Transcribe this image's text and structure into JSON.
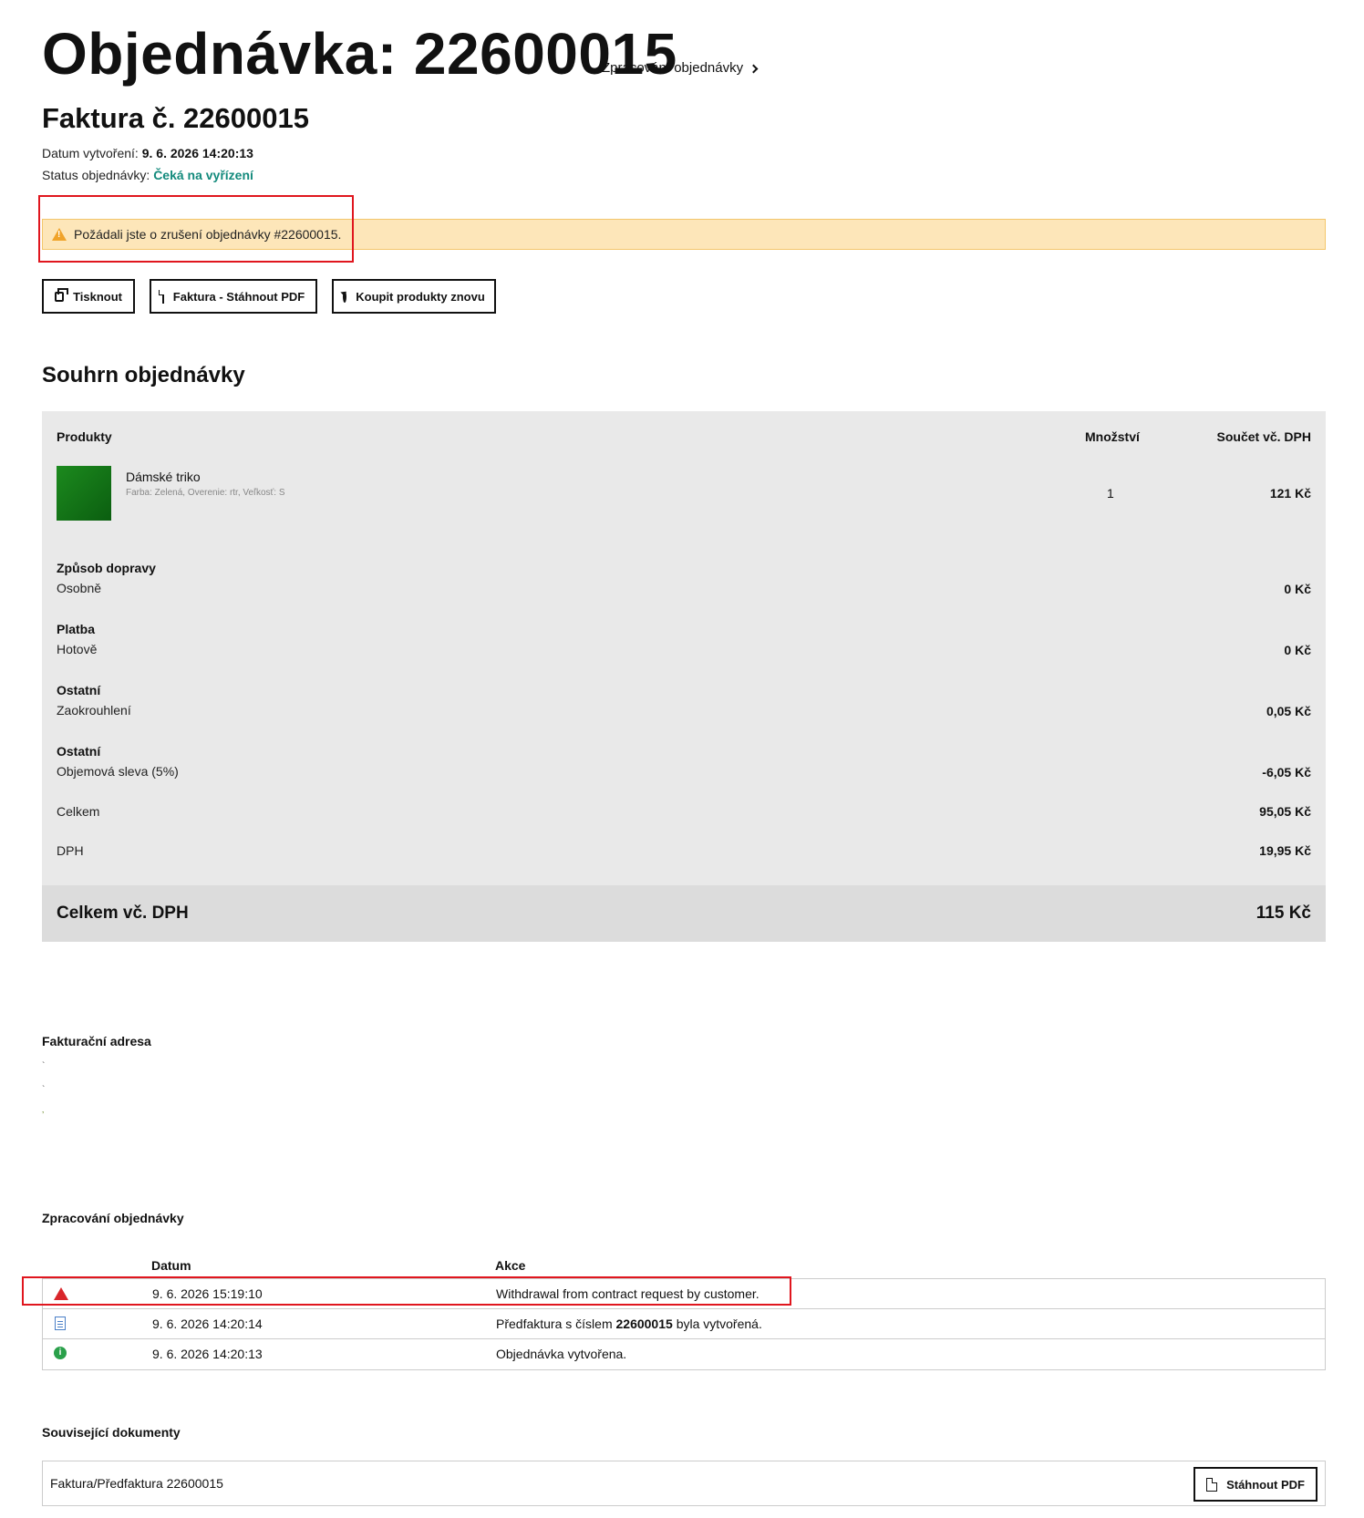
{
  "header": {
    "order_title": "Objednávka: 22600015",
    "processing_link": "Zpracování objednávky",
    "invoice_title": "Faktura č. 22600015",
    "created_label": "Datum vytvoření:",
    "created_value": "9. 6. 2026 14:20:13",
    "status_label": "Status objednávky:",
    "status_value": "Čeká na vyřízení"
  },
  "alert": {
    "text": "Požádali jste o zrušení objednávky #22600015."
  },
  "actions": {
    "print": "Tisknout",
    "invoice_pdf": "Faktura - Stáhnout PDF",
    "buy_again": "Koupit produkty znovu"
  },
  "summary": {
    "title": "Souhrn objednávky",
    "col_products": "Produkty",
    "col_qty": "Množství",
    "col_total": "Součet vč. DPH",
    "product": {
      "name": "Dámské triko",
      "attributes": "Farba: Zelená, Overenie: rtr, Veľkosť: S",
      "qty": "1",
      "total": "121 Kč"
    },
    "lines": [
      {
        "title": "Způsob dopravy",
        "label": "Osobně",
        "value": "0 Kč"
      },
      {
        "title": "Platba",
        "label": "Hotově",
        "value": "0 Kč"
      },
      {
        "title": "Ostatní",
        "label": "Zaokrouhlení",
        "value": "0,05 Kč"
      },
      {
        "title": "Ostatní",
        "label": "Objemová sleva (5%)",
        "value": "-6,05 Kč"
      }
    ],
    "subtotal_label": "Celkem",
    "subtotal_value": "95,05 Kč",
    "vat_label": "DPH",
    "vat_value": "19,95 Kč",
    "grand_label": "Celkem vč. DPH",
    "grand_value": "115 Kč"
  },
  "billing": {
    "title": "Fakturační adresa"
  },
  "history": {
    "title": "Zpracování objednávky",
    "col_date": "Datum",
    "col_action": "Akce",
    "rows": [
      {
        "icon": "alert-icon",
        "date": "9. 6. 2026 15:19:10",
        "action": "Withdrawal from contract request by customer."
      },
      {
        "icon": "document-icon",
        "date": "9. 6. 2026 14:20:14",
        "action_prefix": "Předfaktura s číslem",
        "action_number": "22600015",
        "action_suffix": "byla vytvořená."
      },
      {
        "icon": "info-icon",
        "date": "9. 6. 2026 14:20:13",
        "action": "Objednávka vytvořena."
      }
    ]
  },
  "documents": {
    "title": "Související dokumenty",
    "item": "Faktura/Předfaktura 22600015",
    "download": "Stáhnout PDF"
  },
  "colors": {
    "status": "#138a7c",
    "alert_bg": "#fde6b9",
    "highlight": "#e0161e"
  }
}
